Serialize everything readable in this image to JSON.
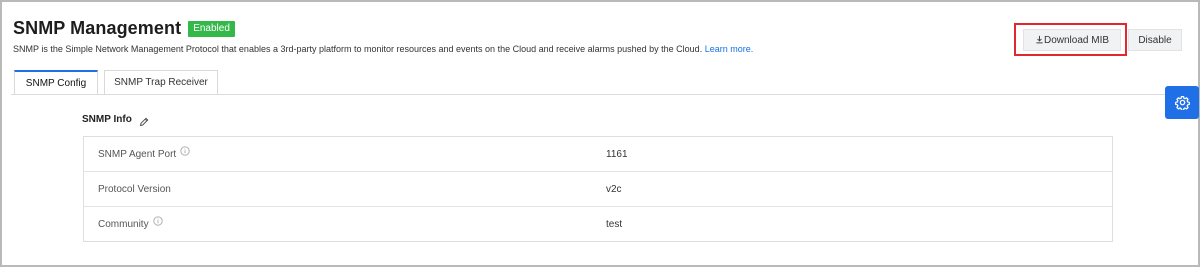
{
  "header": {
    "title": "SNMP Management",
    "status_badge": "Enabled",
    "description": "SNMP is the Simple Network Management Protocol that enables a 3rd-party platform to monitor resources and events on the Cloud and receive alarms pushed by the Cloud.",
    "learn_more": "Learn more."
  },
  "toolbar": {
    "download_label": "Download MIB",
    "download_icon": "download-icon",
    "disable_label": "Disable"
  },
  "tabs": [
    {
      "label": "SNMP Config",
      "active": true
    },
    {
      "label": "SNMP Trap Receiver",
      "active": false
    }
  ],
  "side_button": {
    "icon": "gear-icon"
  },
  "snmp_info": {
    "title": "SNMP Info",
    "edit_icon": "pencil-icon",
    "rows": [
      {
        "label": "SNMP Agent Port",
        "value": "1161",
        "has_info": true
      },
      {
        "label": "Protocol Version",
        "value": "v2c",
        "has_info": false
      },
      {
        "label": "Community",
        "value": "test",
        "has_info": true
      }
    ]
  },
  "colors": {
    "accent": "#1f6fe6",
    "badge": "#34b84a",
    "highlight": "#e0282e"
  }
}
